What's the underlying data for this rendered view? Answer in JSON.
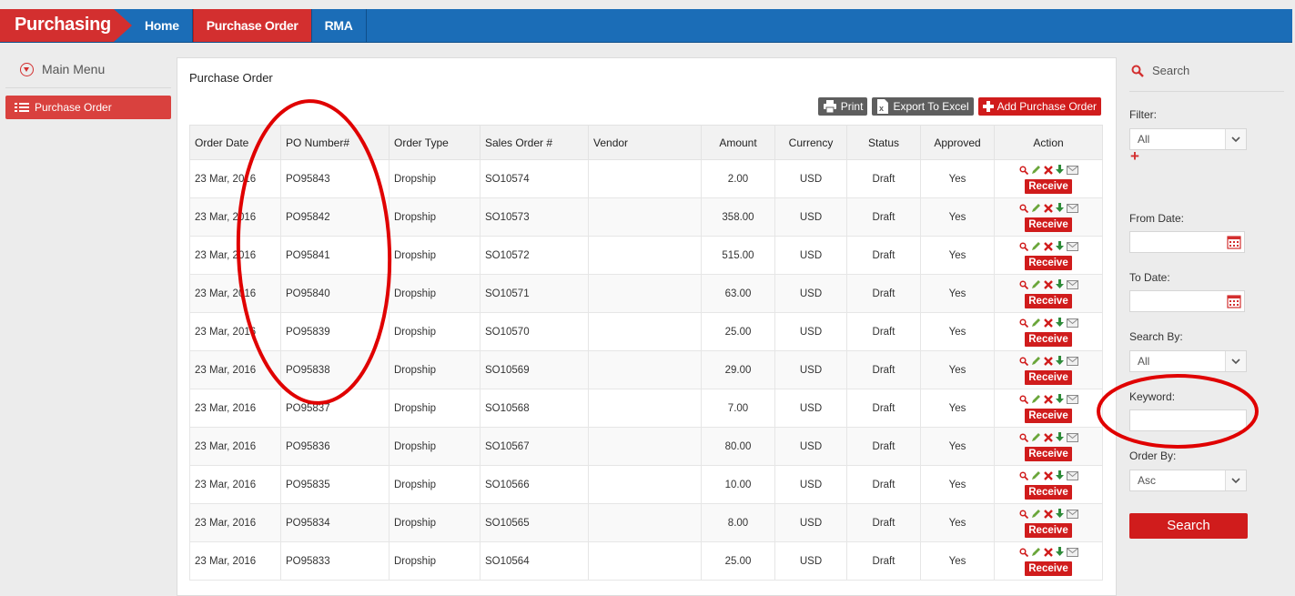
{
  "app": {
    "title": "Purchasing"
  },
  "nav": [
    {
      "label": "Home",
      "active": false
    },
    {
      "label": "Purchase Order",
      "active": true
    },
    {
      "label": "RMA",
      "active": false
    }
  ],
  "sidebar": {
    "menu_title": "Main Menu",
    "items": [
      {
        "label": "Purchase Order",
        "icon": "list-icon",
        "active": true
      }
    ]
  },
  "main": {
    "title": "Purchase Order",
    "buttons": {
      "print": "Print",
      "export": "Export To Excel",
      "add": "Add Purchase Order"
    },
    "columns": [
      "Order Date",
      "PO Number#",
      "Order Type",
      "Sales Order #",
      "Vendor",
      "Amount",
      "Currency",
      "Status",
      "Approved",
      "Action"
    ],
    "receive_label": "Receive",
    "rows": [
      {
        "date": "23 Mar, 2016",
        "po": "PO95843",
        "type": "Dropship",
        "so": "SO10574",
        "vendor": "",
        "amount": "2.00",
        "currency": "USD",
        "status": "Draft",
        "approved": "Yes"
      },
      {
        "date": "23 Mar, 2016",
        "po": "PO95842",
        "type": "Dropship",
        "so": "SO10573",
        "vendor": "",
        "amount": "358.00",
        "currency": "USD",
        "status": "Draft",
        "approved": "Yes"
      },
      {
        "date": "23 Mar, 2016",
        "po": "PO95841",
        "type": "Dropship",
        "so": "SO10572",
        "vendor": "",
        "amount": "515.00",
        "currency": "USD",
        "status": "Draft",
        "approved": "Yes"
      },
      {
        "date": "23 Mar, 2016",
        "po": "PO95840",
        "type": "Dropship",
        "so": "SO10571",
        "vendor": "",
        "amount": "63.00",
        "currency": "USD",
        "status": "Draft",
        "approved": "Yes"
      },
      {
        "date": "23 Mar, 2016",
        "po": "PO95839",
        "type": "Dropship",
        "so": "SO10570",
        "vendor": "",
        "amount": "25.00",
        "currency": "USD",
        "status": "Draft",
        "approved": "Yes"
      },
      {
        "date": "23 Mar, 2016",
        "po": "PO95838",
        "type": "Dropship",
        "so": "SO10569",
        "vendor": "",
        "amount": "29.00",
        "currency": "USD",
        "status": "Draft",
        "approved": "Yes"
      },
      {
        "date": "23 Mar, 2016",
        "po": "PO95837",
        "type": "Dropship",
        "so": "SO10568",
        "vendor": "",
        "amount": "7.00",
        "currency": "USD",
        "status": "Draft",
        "approved": "Yes"
      },
      {
        "date": "23 Mar, 2016",
        "po": "PO95836",
        "type": "Dropship",
        "so": "SO10567",
        "vendor": "",
        "amount": "80.00",
        "currency": "USD",
        "status": "Draft",
        "approved": "Yes"
      },
      {
        "date": "23 Mar, 2016",
        "po": "PO95835",
        "type": "Dropship",
        "so": "SO10566",
        "vendor": "",
        "amount": "10.00",
        "currency": "USD",
        "status": "Draft",
        "approved": "Yes"
      },
      {
        "date": "23 Mar, 2016",
        "po": "PO95834",
        "type": "Dropship",
        "so": "SO10565",
        "vendor": "",
        "amount": "8.00",
        "currency": "USD",
        "status": "Draft",
        "approved": "Yes"
      },
      {
        "date": "23 Mar, 2016",
        "po": "PO95833",
        "type": "Dropship",
        "so": "SO10564",
        "vendor": "",
        "amount": "25.00",
        "currency": "USD",
        "status": "Draft",
        "approved": "Yes"
      }
    ]
  },
  "search": {
    "title": "Search",
    "filter_label": "Filter:",
    "filter_value": "All",
    "from_date_label": "From Date:",
    "to_date_label": "To Date:",
    "search_by_label": "Search By:",
    "search_by_value": "All",
    "keyword_label": "Keyword:",
    "keyword_value": "",
    "order_by_label": "Order By:",
    "order_by_value": "Asc",
    "button": "Search"
  },
  "colors": {
    "brand_red": "#d32f2f",
    "nav_blue": "#1b6db7",
    "approved_green": "#5a9a2f",
    "annotation_red": "#e00000"
  }
}
